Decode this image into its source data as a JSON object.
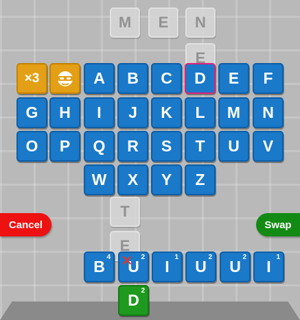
{
  "board_tiles": [
    "M",
    "E",
    "N",
    "E",
    "T",
    "E"
  ],
  "keyboard": {
    "special": [
      {
        "label": "×3"
      },
      {
        "icon": "bandit-mask-icon"
      }
    ],
    "letters": [
      "A",
      "B",
      "C",
      "D",
      "E",
      "F",
      "G",
      "H",
      "I",
      "J",
      "K",
      "L",
      "M",
      "N",
      "O",
      "P",
      "Q",
      "R",
      "S",
      "T",
      "U",
      "V",
      "W",
      "X",
      "Y",
      "Z"
    ],
    "selected_letter": "D"
  },
  "buttons": {
    "cancel": "Cancel",
    "swap": "Swap"
  },
  "rack": [
    {
      "letter": "B",
      "points": "4"
    },
    {
      "letter": "U",
      "points": "2",
      "crossed": true
    },
    {
      "letter": "I",
      "points": "1"
    },
    {
      "letter": "U",
      "points": "2"
    },
    {
      "letter": "U",
      "points": "2"
    },
    {
      "letter": "I",
      "points": "1"
    }
  ],
  "played_tile": {
    "letter": "D",
    "points": "2"
  },
  "colors": {
    "key_blue": "#1a79c9",
    "special_orange": "#e39f15",
    "cancel_red": "#ee1111",
    "swap_green": "#138a13",
    "played_green": "#1e9a1e",
    "selected_border": "#e0207a"
  }
}
